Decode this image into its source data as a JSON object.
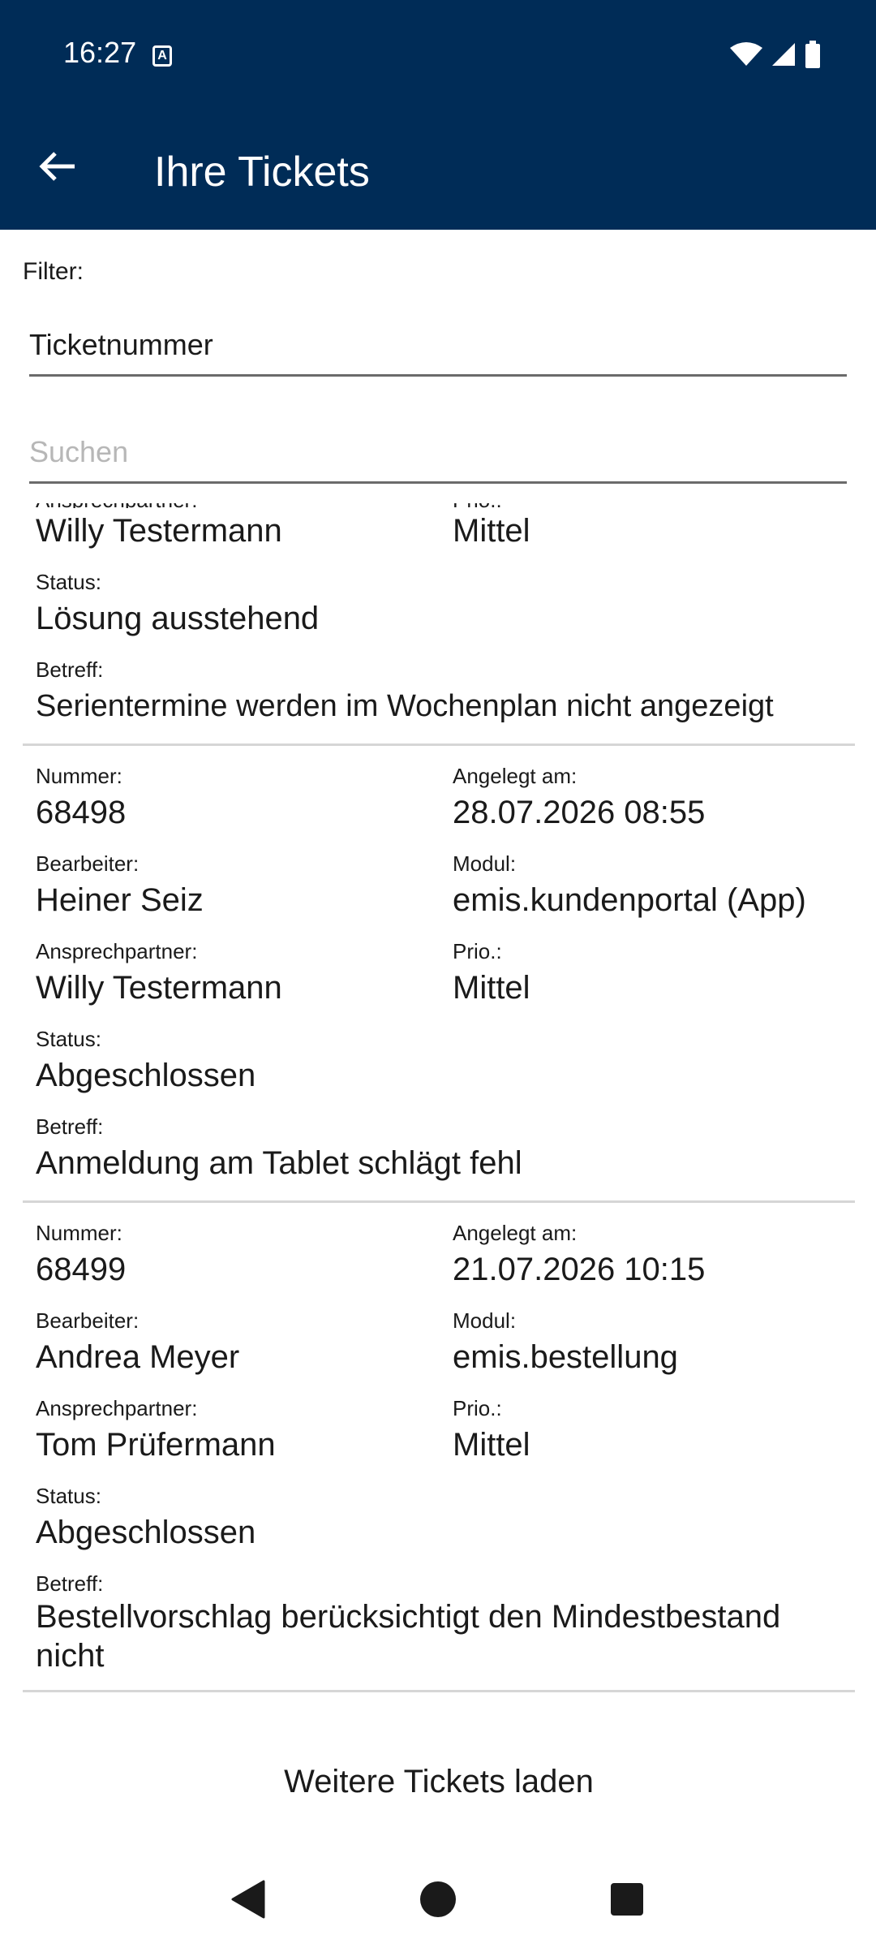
{
  "status_bar": {
    "time": "16:27",
    "notification_icon": "A"
  },
  "app_bar": {
    "title": "Ihre Tickets"
  },
  "filter": {
    "label": "Filter:",
    "selected": "Ticketnummer",
    "search_placeholder": "Suchen"
  },
  "labels": {
    "number": "Nummer:",
    "created": "Angelegt am:",
    "editor": "Bearbeiter:",
    "module": "Modul:",
    "contact": "Ansprechpartner:",
    "priority": "Prio.:",
    "status": "Status:",
    "subject": "Betreff:"
  },
  "tickets": [
    {
      "contact": "Willy Testermann",
      "priority": "Mittel",
      "status": "Lösung ausstehend",
      "subject": "Serientermine werden im Wochenplan nicht angezeigt"
    },
    {
      "number": "68498",
      "created": "28.07.2026 08:55",
      "editor": "Heiner Seiz",
      "module": "emis.kundenportal (App)",
      "contact": "Willy Testermann",
      "priority": "Mittel",
      "status": "Abgeschlossen",
      "subject": "Anmeldung am Tablet schlägt fehl"
    },
    {
      "number": "68499",
      "created": "21.07.2026 10:15",
      "editor": "Andrea Meyer",
      "module": "emis.bestellung",
      "contact": "Tom Prüfermann",
      "priority": "Mittel",
      "status": "Abgeschlossen",
      "subject": "Bestellvorschlag berücksichtigt den Mindestbestand nicht"
    }
  ],
  "load_more": "Weitere Tickets laden",
  "colors": {
    "app_bar": "#002c57",
    "divider": "#d6d6d6"
  }
}
